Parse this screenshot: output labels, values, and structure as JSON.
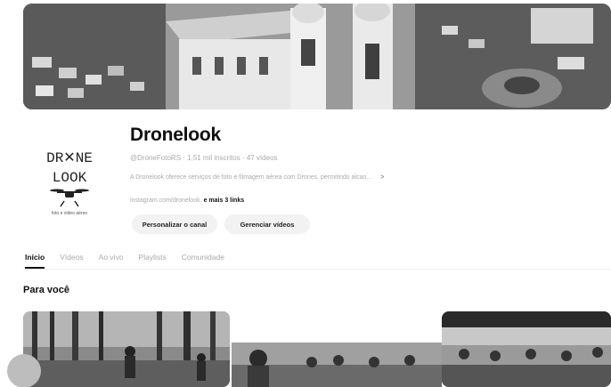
{
  "channel": {
    "name": "Dronelook",
    "meta": "@DroneFotoRS · 1,51 mil inscritos · 47 vídeos",
    "description": "A Dronelook oferece serviços de foto e filmagem aérea com Drones, permitindo alcan...",
    "description_more": ">",
    "links_prefix": "instagram.com/dronelook",
    "links_more": "e mais 3 links",
    "logo_line1": "DR✕NE",
    "logo_line2": "LOOK",
    "logo_tagline": "foto e vídeo aéreo"
  },
  "actions": {
    "customize": "Personalizar o canal",
    "manage": "Gerenciar vídeos"
  },
  "tabs": [
    "Início",
    "Vídeos",
    "Ao vivo",
    "Playlists",
    "Comunidade"
  ],
  "active_tab": "Início",
  "section": {
    "title": "Para você"
  },
  "colors": {
    "text": "#0f0f0f",
    "muted": "#aaaaaa",
    "button_bg": "#f2f2f2"
  }
}
